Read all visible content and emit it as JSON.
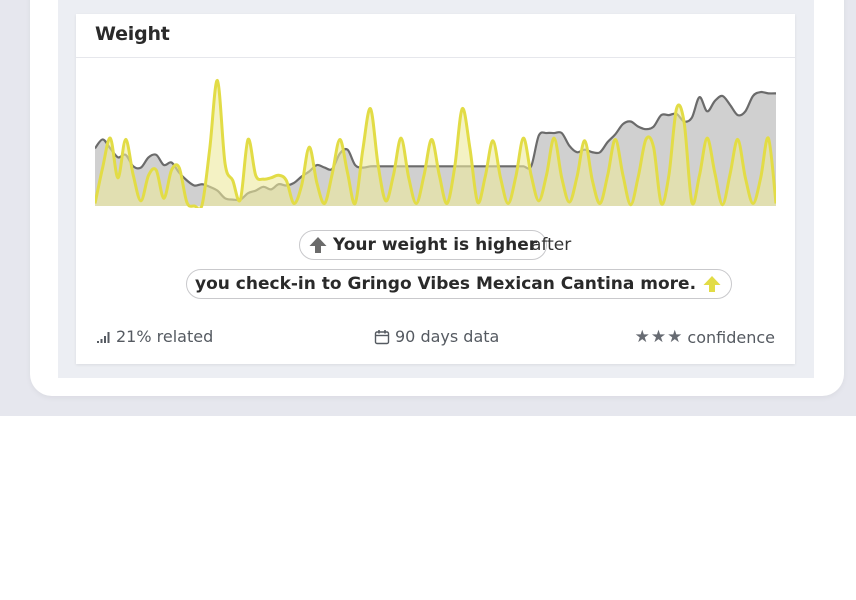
{
  "card": {
    "title": "Weight"
  },
  "insight": {
    "line1_bold": "Your weight is higher",
    "line1_after": "after",
    "line2_bold": "you check-in to Gringo Vibes Mexican Cantina more.",
    "direction_icon_1": "arrow-up-icon",
    "direction_icon_2": "arrow-up-icon",
    "color_arrow_1": "#6b6b6b",
    "color_arrow_2": "#e2dc46"
  },
  "footer": {
    "related": "21% related",
    "days": "90 days data",
    "confidence": "confidence",
    "confidence_stars": 3,
    "related_icon": "signal-bars-icon",
    "days_icon": "calendar-icon",
    "star_icon": "star-icon"
  },
  "chart_data": {
    "type": "area",
    "xlabel": "",
    "ylabel": "",
    "grid": false,
    "legend": "none",
    "series": [
      {
        "color": "#6b6b6b",
        "fill": "#c8c8c8",
        "values": [
          0.45,
          0.52,
          0.45,
          0.38,
          0.4,
          0.31,
          0.3,
          0.38,
          0.4,
          0.32,
          0.34,
          0.26,
          0.2,
          0.16,
          0.17,
          0.15,
          0.12,
          0.06,
          0.05,
          0.05,
          0.1,
          0.12,
          0.15,
          0.13,
          0.17,
          0.16,
          0.18,
          0.23,
          0.27,
          0.32,
          0.3,
          0.29,
          0.41,
          0.44,
          0.32,
          0.3,
          0.31,
          0.31,
          0.31,
          0.31,
          0.31,
          0.31,
          0.31,
          0.31,
          0.31,
          0.31,
          0.31,
          0.31,
          0.31,
          0.31,
          0.31,
          0.31,
          0.31,
          0.31,
          0.31,
          0.31,
          0.31,
          0.31,
          0.55,
          0.57,
          0.57,
          0.57,
          0.47,
          0.42,
          0.44,
          0.42,
          0.42,
          0.5,
          0.56,
          0.64,
          0.66,
          0.62,
          0.6,
          0.62,
          0.71,
          0.71,
          0.72,
          0.66,
          0.69,
          0.85,
          0.74,
          0.82,
          0.86,
          0.79,
          0.71,
          0.74,
          0.86,
          0.89,
          0.88,
          0.88
        ]
      },
      {
        "color": "#e2dc46",
        "fill": "#ede99c",
        "values": [
          0.02,
          0.3,
          0.53,
          0.22,
          0.52,
          0.24,
          0.04,
          0.24,
          0.28,
          0.06,
          0.28,
          0.3,
          0.03,
          0.0,
          0.01,
          0.45,
          0.98,
          0.33,
          0.2,
          0.05,
          0.52,
          0.24,
          0.21,
          0.22,
          0.24,
          0.2,
          0.02,
          0.16,
          0.46,
          0.18,
          0.02,
          0.25,
          0.52,
          0.26,
          0.02,
          0.44,
          0.76,
          0.32,
          0.04,
          0.24,
          0.53,
          0.22,
          0.02,
          0.24,
          0.52,
          0.24,
          0.02,
          0.3,
          0.76,
          0.45,
          0.03,
          0.23,
          0.51,
          0.22,
          0.02,
          0.23,
          0.53,
          0.24,
          0.04,
          0.24,
          0.53,
          0.22,
          0.03,
          0.23,
          0.51,
          0.2,
          0.02,
          0.24,
          0.52,
          0.24,
          0.01,
          0.23,
          0.52,
          0.46,
          0.02,
          0.24,
          0.76,
          0.65,
          0.03,
          0.24,
          0.53,
          0.26,
          0.01,
          0.25,
          0.52,
          0.22,
          0.02,
          0.22,
          0.53,
          0.02
        ]
      }
    ]
  }
}
